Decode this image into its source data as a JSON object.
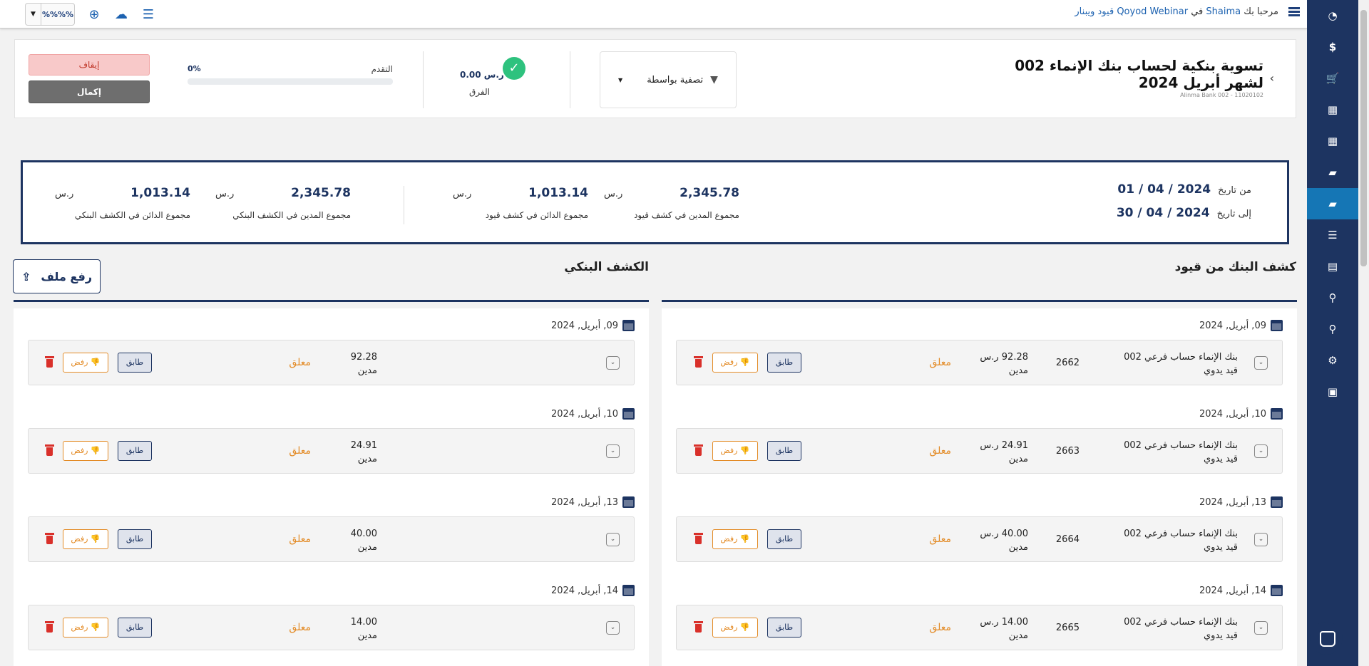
{
  "topbar": {
    "greeting_prefix": "مرحبا بك",
    "user": "Shaima",
    "in": "في",
    "org": "Qoyod Webinar",
    "org_ar": "قيود ويبنار",
    "toggle_label": "%%%%"
  },
  "sidebar": {
    "items": [
      {
        "icon": "dashboard-icon",
        "glyph": "◔"
      },
      {
        "icon": "dollar-icon",
        "glyph": "$"
      },
      {
        "icon": "cart-icon",
        "glyph": "🛒"
      },
      {
        "icon": "grid-icon",
        "glyph": "▦"
      },
      {
        "icon": "grid-icon-2",
        "glyph": "▦"
      },
      {
        "icon": "folder-icon",
        "glyph": "▰"
      },
      {
        "icon": "folder-open-icon",
        "glyph": "▰"
      },
      {
        "icon": "list-icon",
        "glyph": "☰"
      },
      {
        "icon": "document-icon",
        "glyph": "▤"
      },
      {
        "icon": "search-icon",
        "glyph": "⚲"
      },
      {
        "icon": "search-icon-2",
        "glyph": "⚲"
      },
      {
        "icon": "gear-icon",
        "glyph": "⚙"
      },
      {
        "icon": "calculator-icon",
        "glyph": "▣"
      }
    ]
  },
  "header": {
    "title_line1": "تسوية بنكية لحساب بنك الإنماء 002",
    "title_line2": "لشهر أبريل 2024",
    "subtitle": "Alinma Bank 002 - 11020102",
    "filter_label": "تصفية بواسطة",
    "difference_amount": "0.00 ر.س",
    "difference_label": "الفرق",
    "progress_label": "التقدم",
    "progress_value": "0%",
    "progress_fraction": 0,
    "stop_label": "إيقاف",
    "complete_label": "إكمال"
  },
  "summary": {
    "from_label": "من تاريخ",
    "from_date": "2024 / 04 / 01",
    "to_label": "إلى تاريخ",
    "to_date": "2024 / 04 / 30",
    "stats": [
      {
        "value": "2,345.78",
        "currency": "ر.س",
        "label": "مجموع المدين في كشف قيود"
      },
      {
        "value": "1,013.14",
        "currency": "ر.س",
        "label": "مجموع الدائن في كشف قيود"
      },
      {
        "value": "2,345.78",
        "currency": "ر.س",
        "label": "مجموع المدين في الكشف البنكي"
      },
      {
        "value": "1,013.14",
        "currency": "ر.س",
        "label": "مجموع الدائن في الكشف البنكي"
      }
    ]
  },
  "sections": {
    "qoyod_title": "كشف البنك من قيود",
    "bank_title": "الكشف البنكي",
    "upload_label": "رفع ملف"
  },
  "labels": {
    "match": "طابق",
    "reject": "رفض",
    "status": "معلق",
    "debit": "مدين",
    "manual": "قيد يدوي"
  },
  "qoyod_entries": [
    {
      "date": "09, أبريل, 2024",
      "desc": "بنك الإنماء حساب فرعي 002",
      "num": "2662",
      "amount": "92.28 ر.س"
    },
    {
      "date": "10, أبريل, 2024",
      "desc": "بنك الإنماء حساب فرعي 002",
      "num": "2663",
      "amount": "24.91 ر.س"
    },
    {
      "date": "13, أبريل, 2024",
      "desc": "بنك الإنماء حساب فرعي 002",
      "num": "2664",
      "amount": "40.00 ر.س"
    },
    {
      "date": "14, أبريل, 2024",
      "desc": "بنك الإنماء حساب فرعي 002",
      "num": "2665",
      "amount": "14.00 ر.س"
    }
  ],
  "bank_entries": [
    {
      "date": "09, أبريل, 2024",
      "amount": "92.28"
    },
    {
      "date": "10, أبريل, 2024",
      "amount": "24.91"
    },
    {
      "date": "13, أبريل, 2024",
      "amount": "40.00"
    },
    {
      "date": "14, أبريل, 2024",
      "amount": "14.00"
    }
  ]
}
